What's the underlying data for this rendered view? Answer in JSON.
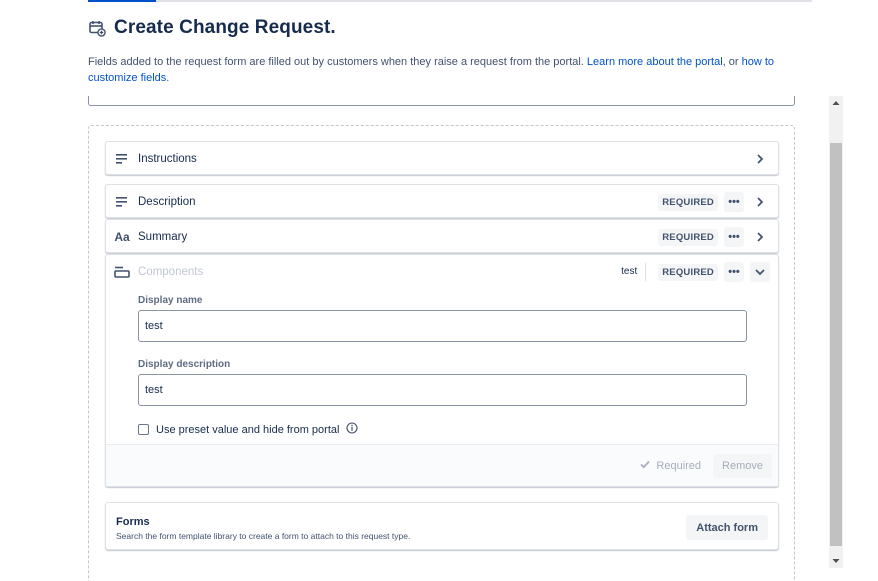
{
  "header": {
    "title": "Create Change Request."
  },
  "description": {
    "text1": "Fields added to the request form are filled out by customers when they raise a request from the portal. ",
    "link1": "Learn more about the portal",
    "text2": ", or ",
    "link2": "how to customize fields",
    "text3": "."
  },
  "fields": {
    "instructions": {
      "label": "Instructions"
    },
    "description": {
      "label": "Description",
      "required": "REQUIRED",
      "more": "•••"
    },
    "summary": {
      "label": "Summary",
      "icon_text": "Aa",
      "required": "REQUIRED",
      "more": "•••"
    },
    "components": {
      "label": "Components",
      "preset_value": "test",
      "required": "REQUIRED",
      "more": "•••",
      "display_name_label": "Display name",
      "display_name_value": "test",
      "display_description_label": "Display description",
      "display_description_value": "test",
      "preset_checkbox_label": "Use preset value and hide from portal",
      "required_checkbox_label": "Required",
      "remove_label": "Remove"
    }
  },
  "forms": {
    "title": "Forms",
    "subtitle": "Search the form template library to create a form to attach to this request type.",
    "attach_label": "Attach form"
  },
  "icons": {
    "header": "calendar-plus-icon",
    "instructions": "text-lines-icon",
    "description": "text-lines-icon",
    "summary": "text-format-icon",
    "components": "component-box-icon"
  },
  "colors": {
    "link": "#0052cc",
    "text": "#172b4d",
    "muted": "#a5adba"
  }
}
